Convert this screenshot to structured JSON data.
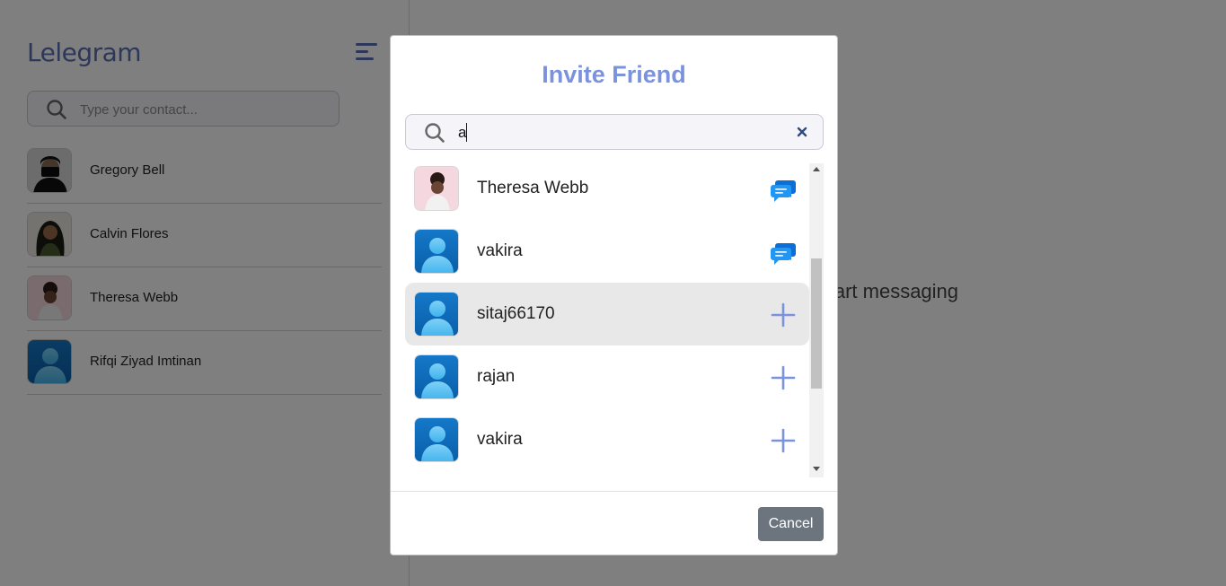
{
  "app": {
    "title": "Lelegram",
    "search_placeholder": "Type your contact...",
    "main_placeholder": "Select a chat to start messaging"
  },
  "contacts": [
    {
      "name": "Gregory Bell",
      "avatar": "photo"
    },
    {
      "name": "Calvin Flores",
      "avatar": "photo"
    },
    {
      "name": "Theresa Webb",
      "avatar": "photo"
    },
    {
      "name": "Rifqi Ziyad Imtinan",
      "avatar": "default-user-icon"
    }
  ],
  "modal": {
    "title": "Invite Friend",
    "search_value": "a",
    "results": [
      {
        "name": "Theresa Webb",
        "avatar": "photo",
        "action": "chat-icon"
      },
      {
        "name": "vakira",
        "avatar": "default-user-icon",
        "action": "chat-icon"
      },
      {
        "name": "sitaj66170",
        "avatar": "default-user-icon",
        "action": "add-icon"
      },
      {
        "name": "rajan",
        "avatar": "default-user-icon",
        "action": "add-icon"
      },
      {
        "name": "vakira",
        "avatar": "default-user-icon",
        "action": "add-icon"
      }
    ],
    "cancel_label": "Cancel"
  },
  "colors": {
    "brand": "#5a6fb5",
    "modal_title": "#7b93dc",
    "add_icon": "#7b93dc",
    "chat_icon": "#1e88e5",
    "cancel_button": "#6c757d"
  }
}
